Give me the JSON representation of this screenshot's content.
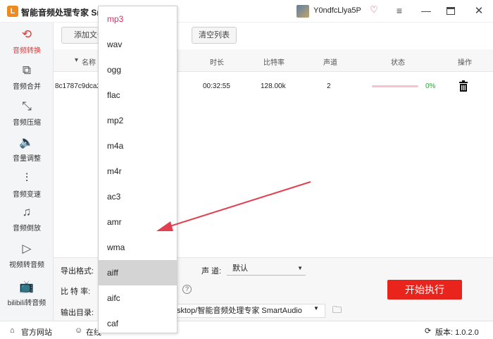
{
  "app": {
    "title": "智能音频处理专家 Sm",
    "logo_text": "L"
  },
  "user": {
    "name": "Y0ndfcLlya5P"
  },
  "sidebar": {
    "items": [
      {
        "label": "音频转换",
        "icon": "convert-icon",
        "glyph": "⟲"
      },
      {
        "label": "音频合并",
        "icon": "merge-icon",
        "glyph": "⧉"
      },
      {
        "label": "音频压缩",
        "icon": "compress-icon",
        "glyph": "⤡"
      },
      {
        "label": "音量调整",
        "icon": "volume-icon",
        "glyph": "🔈"
      },
      {
        "label": "音频变速",
        "icon": "speed-icon",
        "glyph": "⫶"
      },
      {
        "label": "音频倒放",
        "icon": "reverse-icon",
        "glyph": "♫"
      },
      {
        "label": "视频转音频",
        "icon": "video-to-audio-icon",
        "glyph": "▷"
      },
      {
        "label": "bilibili转音频",
        "icon": "bilibili-icon",
        "glyph": "📺"
      }
    ]
  },
  "toolbar": {
    "add_file": "添加文件",
    "clear_list": "清空列表"
  },
  "table": {
    "headers": {
      "name": "名称 (",
      "duration": "时长",
      "bitrate": "比特率",
      "channels": "声道",
      "status": "状态",
      "action": "操作"
    },
    "rows": [
      {
        "name": "8c1787c9dca2",
        "duration": "00:32:55",
        "bitrate": "128.00k",
        "channels": "2",
        "progress_percent": 0,
        "progress_text": "0%"
      }
    ]
  },
  "settings": {
    "format_label": "导出格式:",
    "bitrate_label": "比 特 率:",
    "output_label": "输出目录:",
    "channel_label": "声 道:",
    "channel_value": "默认",
    "output_path": "sktop/智能音频处理专家 SmartAudio",
    "start_button": "开始执行"
  },
  "statusbar": {
    "website": "官方网站",
    "online": "在线",
    "version": "版本: 1.0.2.0"
  },
  "format_dropdown": {
    "options": [
      "mp3",
      "wav",
      "ogg",
      "flac",
      "mp2",
      "m4a",
      "m4r",
      "ac3",
      "amr",
      "wma",
      "aiff",
      "aifc",
      "caf"
    ],
    "selected": "mp3",
    "hovered": "aiff"
  },
  "colors": {
    "accent": "#e8241c",
    "selected_option": "#e8245e",
    "active_sidebar": "#e53935",
    "annotation_arrow": "#e04050"
  }
}
